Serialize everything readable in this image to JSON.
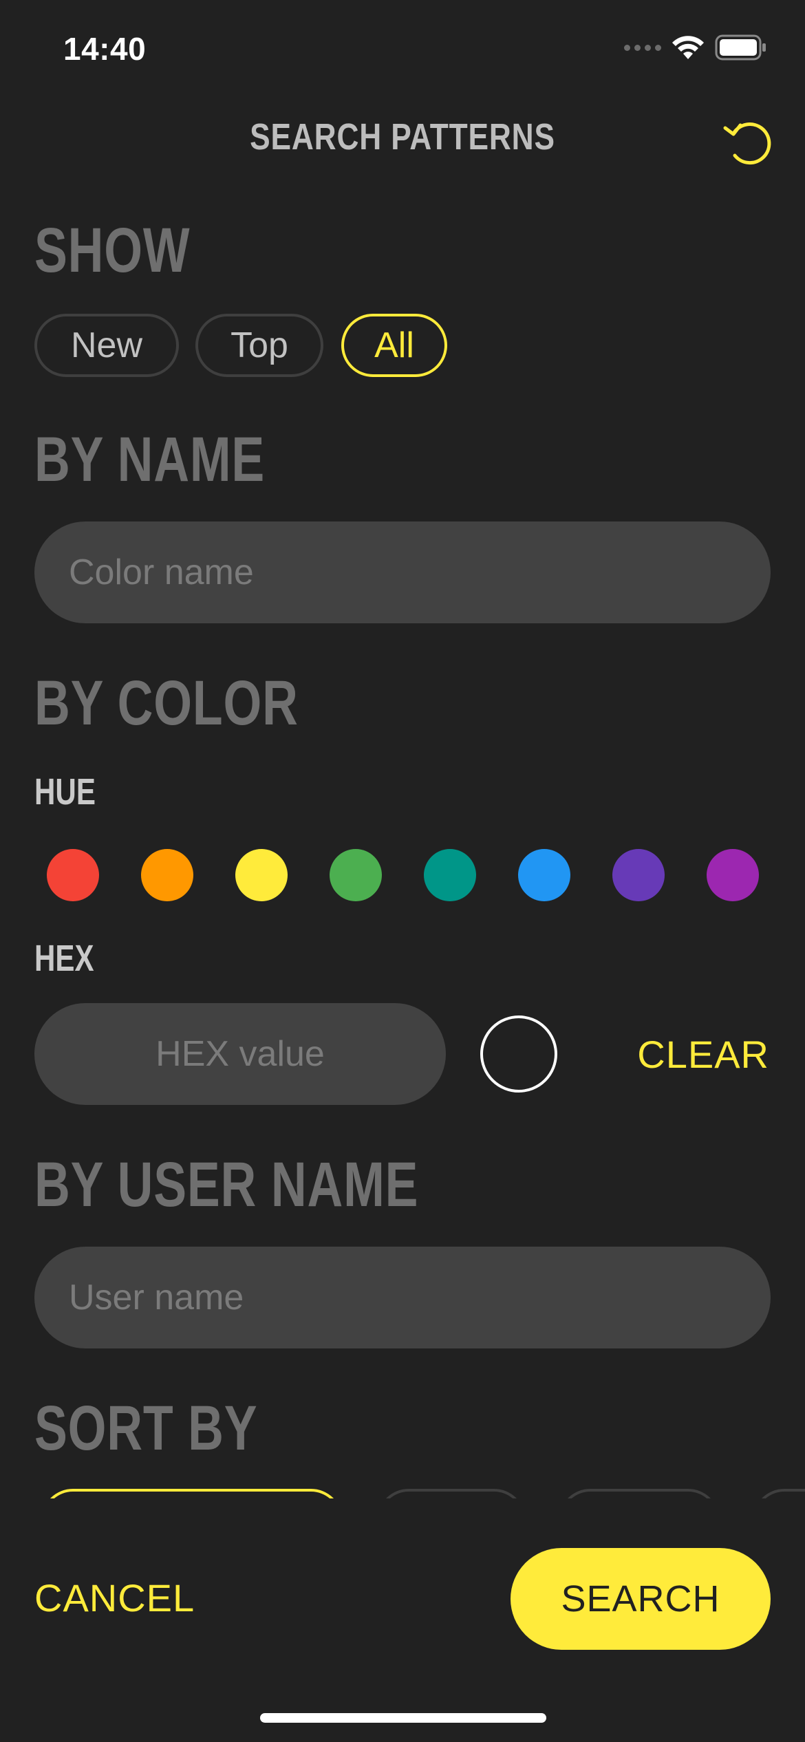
{
  "status_bar": {
    "time": "14:40",
    "icons": [
      "signal-icon",
      "wifi-icon",
      "battery-icon"
    ]
  },
  "header": {
    "title": "SEARCH PATTERNS",
    "reset_icon": "reset-icon"
  },
  "show": {
    "title": "SHOW",
    "options": [
      "New",
      "Top",
      "All"
    ],
    "selected": "All"
  },
  "by_name": {
    "title": "BY NAME",
    "placeholder": "Color name",
    "value": ""
  },
  "by_color": {
    "title": "BY COLOR",
    "hue_label": "HUE",
    "hues": [
      "#f44336",
      "#ff9800",
      "#ffeb3b",
      "#4caf50",
      "#009688",
      "#2196f3",
      "#673ab7",
      "#9c27b0"
    ],
    "hex_label": "HEX",
    "hex_placeholder": "HEX value",
    "hex_value": "",
    "clear_label": "CLEAR"
  },
  "by_user_name": {
    "title": "BY USER NAME",
    "placeholder": "User name",
    "value": ""
  },
  "sort_by": {
    "title": "SORT BY"
  },
  "footer": {
    "cancel_label": "CANCEL",
    "search_label": "SEARCH"
  },
  "colors": {
    "accent": "#ffeb3b",
    "background": "#212121",
    "input_bg": "#424242"
  }
}
